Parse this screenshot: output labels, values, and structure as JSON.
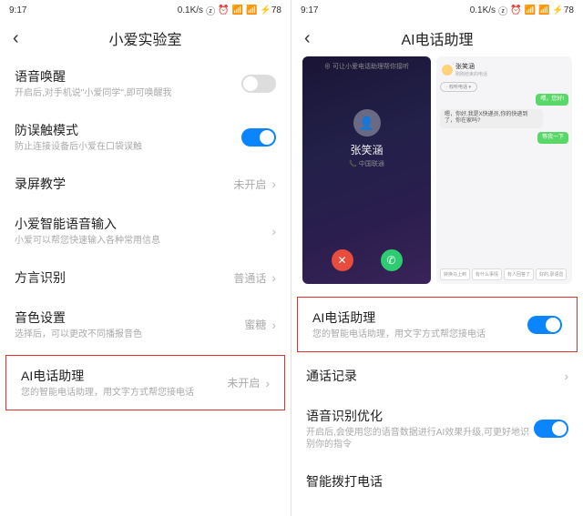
{
  "status": {
    "time": "9:17",
    "speed": "0.1K/s",
    "battery": "78"
  },
  "left": {
    "title": "小爱实验室",
    "items": [
      {
        "label": "语音唤醒",
        "desc": "开启后,对手机说\"小爱同学\",即可唤醒我",
        "toggle": "off"
      },
      {
        "label": "防误触模式",
        "desc": "防止连接设备后小爱在口袋误触",
        "toggle": "on"
      },
      {
        "label": "录屏教学",
        "value": "未开启"
      },
      {
        "label": "小爱智能语音输入",
        "desc": "小爱可以帮您快速输入各种常用信息"
      },
      {
        "label": "方言识别",
        "value": "普通话"
      },
      {
        "label": "音色设置",
        "desc": "选择后，可以更改不同播报音色",
        "value": "蜜糖"
      },
      {
        "label": "AI电话助理",
        "desc": "您的智能电话助理，用文字方式帮您接电话",
        "value": "未开启",
        "highlight": true
      }
    ]
  },
  "right": {
    "title": "AI电话助理",
    "call": {
      "top": "⊕ 可让小爱电话助理帮你接听",
      "name": "张笑涵",
      "sub": "📞 中国联通"
    },
    "chat": {
      "name": "张笑涵",
      "sub": "刚刚结束的电话",
      "pill": "· 收听电话 ▾",
      "b1": "喂，您好!",
      "b2": "嗯，你好,我是X快递员,你的快递到了，你在家吗?",
      "b3": "等我一下",
      "q": [
        "转换马上到",
        "有什么事情",
        "有人回答了",
        "好的,录语音"
      ]
    },
    "items": [
      {
        "label": "AI电话助理",
        "desc": "您的智能电话助理，用文字方式帮您接电话",
        "toggle": "on",
        "highlight": true
      },
      {
        "label": "通话记录"
      },
      {
        "label": "语音识别优化",
        "desc": "开启后,会使用您的语音数据进行AI效果升级,可更好地识别你的指令",
        "toggle": "on"
      },
      {
        "label": "智能拨打电话"
      }
    ]
  }
}
